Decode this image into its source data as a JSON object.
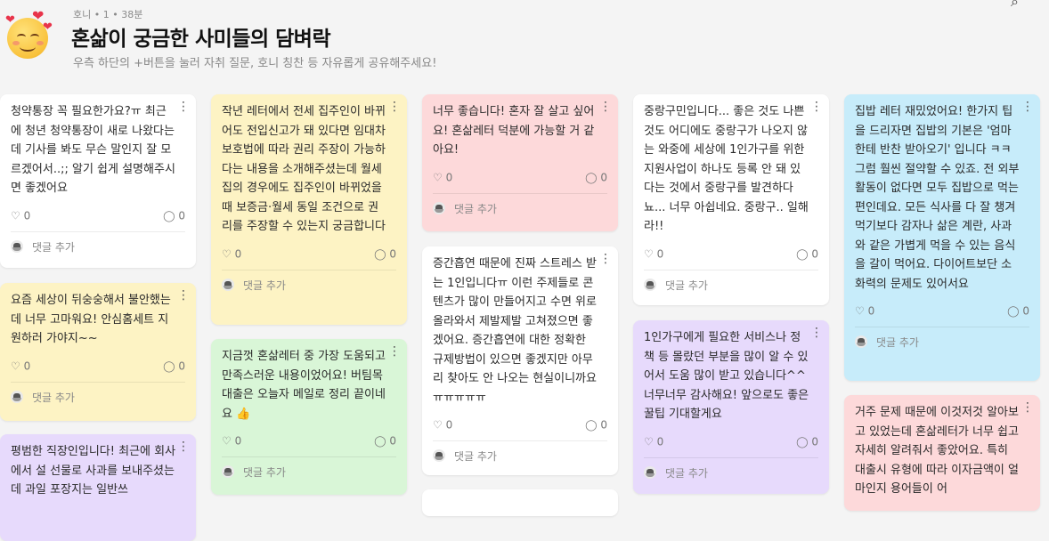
{
  "header": {
    "meta": "호니 • 1 •  38분",
    "title": "혼삶이 궁금한 사미들의 담벼락",
    "subtitle": "우측 하단의 +버튼을 눌러 자취 질문, 호니 칭찬 등 자유롭게 공유해주세요!"
  },
  "common": {
    "reply_label": "댓글 추가",
    "menu_glyph": "⋮",
    "heart_glyph": "♡",
    "comment_glyph": "◯"
  },
  "colors": {
    "white": "#ffffff",
    "yellow": "#fdf3c4",
    "pink": "#fdd9da",
    "green": "#d9f6d7",
    "purple": "#e7dafc",
    "blue": "#c7ecfa"
  },
  "cards": [
    {
      "text": "청약통장 꼭 필요한가요?ㅠ 최근에 청년 청약통장이 새로 나왔다는데 기사를 봐도 무슨 말인지 잘 모르겠어서..;; 알기 쉽게 설명해주시면 좋겠어요",
      "likes": "0",
      "comments": "0",
      "color": "white"
    },
    {
      "text": "요즘 세상이 뒤숭숭해서 불안했는데 너무 고마워요! 안심홈세트 지원하러 가야지~~",
      "likes": "0",
      "comments": "0",
      "color": "yellow"
    },
    {
      "text": "평범한 직장인입니다! 최근에 회사에서 설 선물로 사과를 보내주셨는데 과일 포장지는 일반쓰",
      "likes": "0",
      "comments": "0",
      "color": "purple"
    },
    {
      "text": "작년 레터에서 전세 집주인이 바뀌어도 전입신고가 돼 있다면 임대차보호법에 따라 권리 주장이 가능하다는 내용을 소개해주셨는데 월세집의 경우에도 집주인이 바뀌었을 때 보증금·월세 동일 조건으로 권리를 주장할 수 있는지 궁금합니다",
      "likes": "0",
      "comments": "0",
      "color": "yellow"
    },
    {
      "text": "지금껏 혼삶레터 중 가장 도움되고 만족스러운 내용이었어요! 버팀목 대출은 오늘자 메일로 정리 끝이네요 👍",
      "likes": "0",
      "comments": "0",
      "color": "green"
    },
    {
      "text": "너무 좋습니다! 혼자 잘 살고 싶어요! 혼삶레터 덕분에 가능할 거 같아요!",
      "likes": "0",
      "comments": "0",
      "color": "pink"
    },
    {
      "text": "증간흡연 때문에 진짜 스트레스 받는 1인입니다ㅠ 이런 주제들로 콘텐츠가 많이 만들어지고 수면 위로 올라와서 제발제발 고쳐졌으면 좋겠어요. 증간흡연에 대한 정확한 규제방법이 있으면 좋겠지만 아무리 찾아도 안 나오는 현실이니까요 ㅠㅠㅠㅠㅠ",
      "likes": "0",
      "comments": "0",
      "color": "white"
    },
    {
      "text": "중랑구민입니다... 좋은 것도 나쁜 것도 어디에도 중랑구가 나오지 않는 와중에 세상에 1인가구를 위한 지원사업이 하나도 등록 안 돼 있다는 것에서 중랑구를 발견하다뇨... 너무 아쉽네요. 중랑구.. 일해라!!",
      "likes": "0",
      "comments": "0",
      "color": "white"
    },
    {
      "text": "1인가구에게 필요한 서비스나 정책 등 몰랐던 부분을 많이 알 수 있어서 도움 많이 받고 있습니다^^ 너무너무 감사해요! 앞으로도 좋은 꿀팁 기대할게요",
      "likes": "0",
      "comments": "0",
      "color": "purple"
    },
    {
      "text": "집밥 레터 재밌었어요! 한가지 팁을 드리자면 집밥의 기본은 '엄마한테 반찬 받아오기' 입니다 ㅋㅋ 그럼 훨씬 절약할 수 있죠. 전 외부활동이 없다면 모두 집밥으로 먹는 편인데요. 모든 식사를 다 잘 챙겨먹기보다 감자나 삶은 계란, 사과와 같은 가볍게 먹을 수 있는 음식을 갈이 먹어요. 다이어트보단 소화력의 문제도 있어서요",
      "likes": "0",
      "comments": "0",
      "color": "blue"
    },
    {
      "text": "거주 문제 때문에 이것저것 알아보고 있었는데 혼삶레터가 너무 쉽고 자세히 알려줘서 좋았어요. 특히 대출시 유형에 따라 이자금액이 얼마인지 용어들이 어",
      "likes": "0",
      "comments": "0",
      "color": "pink"
    }
  ]
}
